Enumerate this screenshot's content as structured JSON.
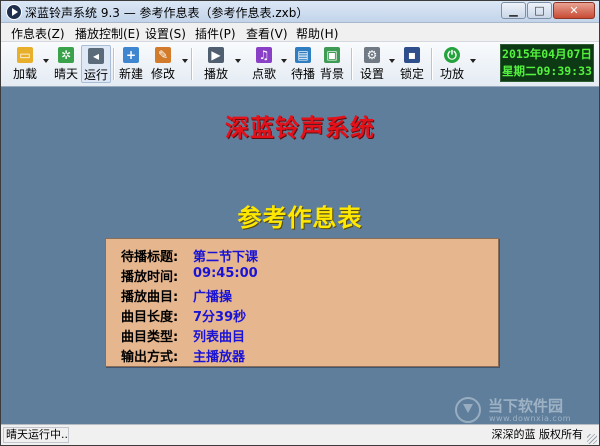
{
  "window": {
    "title": "深蓝铃声系统 9.3 — 参考作息表（参考作息表.zxb）"
  },
  "menu": [
    {
      "label": "作息表(Z)"
    },
    {
      "label": "播放控制(E)"
    },
    {
      "label": "设置(S)"
    },
    {
      "label": "插件(P)"
    },
    {
      "label": "查看(V)"
    },
    {
      "label": "帮助(H)"
    }
  ],
  "toolbar": {
    "buttons": [
      {
        "label": "加载",
        "icon": "folder-open-icon",
        "color": "#e8b02a"
      },
      {
        "label": "晴天",
        "icon": "sun-weather-icon",
        "color": "#3aa24a"
      },
      {
        "label": "运行",
        "icon": "speaker-icon",
        "color": "#5b6b7a"
      },
      {
        "label": "新建",
        "icon": "new-document-icon",
        "color": "#3f86d0"
      },
      {
        "label": "修改",
        "icon": "edit-document-icon",
        "color": "#d27b2a"
      },
      {
        "label": "播放",
        "icon": "play-icon",
        "color": "#4f5f6f"
      },
      {
        "label": "点歌",
        "icon": "music-note-icon",
        "color": "#8a3fc7"
      },
      {
        "label": "待播",
        "icon": "queue-window-icon",
        "color": "#2f7ec2"
      },
      {
        "label": "背景",
        "icon": "background-image-icon",
        "color": "#3e9b54"
      },
      {
        "label": "设置",
        "icon": "gear-icon",
        "color": "#707a85"
      },
      {
        "label": "锁定",
        "icon": "lock-icon",
        "color": "#2e4f8c"
      },
      {
        "label": "功放",
        "icon": "power-icon",
        "color": "#24a33c"
      }
    ],
    "clock": {
      "date": "2015年04月07日",
      "weekday_time": "星期二09:39:33"
    }
  },
  "main": {
    "system_title": "深蓝铃声系统",
    "schedule_title": "参考作息表",
    "info": [
      {
        "key": "待播标题:",
        "value": "第二节下课"
      },
      {
        "key": "播放时间:",
        "value": "09:45:00"
      },
      {
        "key": "播放曲目:",
        "value": "广播操"
      },
      {
        "key": "曲目长度:",
        "value": "7分39秒"
      },
      {
        "key": "曲目类型:",
        "value": "列表曲目"
      },
      {
        "key": "输出方式:",
        "value": "主播放器"
      }
    ],
    "watermark": {
      "text": "当下软件园",
      "sub": "www.downxia.com"
    }
  },
  "status": {
    "left": "晴天运行中...",
    "right": "深深的蓝 版权所有"
  }
}
